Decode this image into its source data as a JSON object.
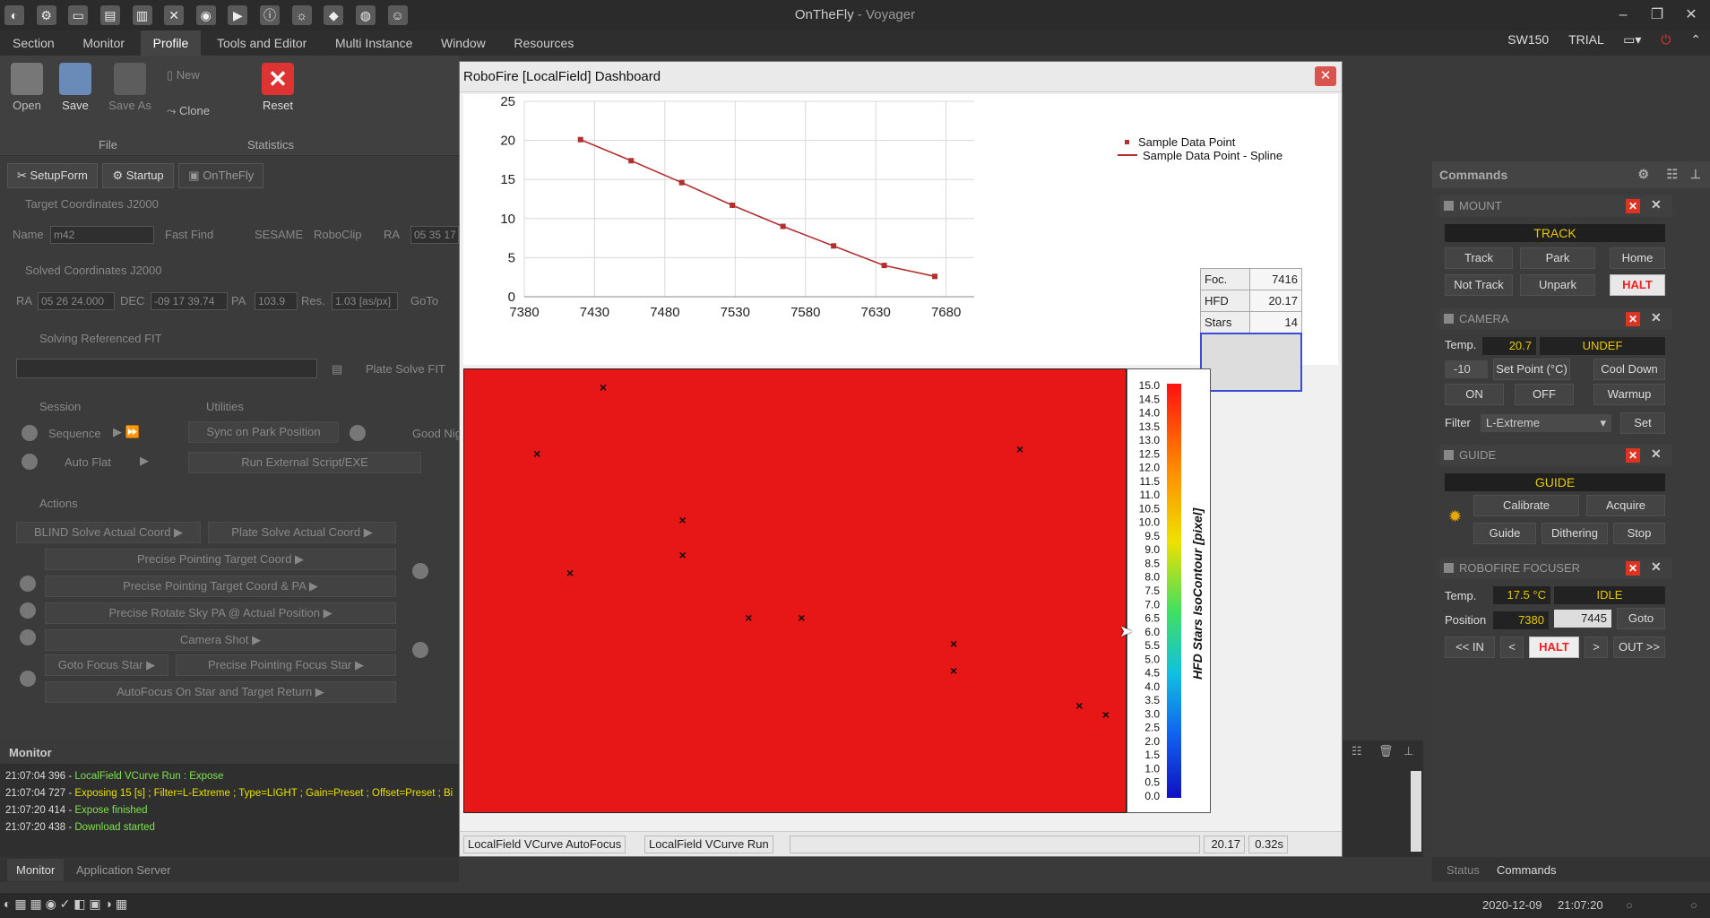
{
  "app": {
    "title": "OnTheFly",
    "subtitle": " - Voyager"
  },
  "menu": [
    "Section",
    "Monitor",
    "Profile",
    "Tools and Editor",
    "Multi Instance",
    "Window",
    "Resources"
  ],
  "topright": {
    "sw": "SW150",
    "trial": "TRIAL"
  },
  "ribbon": {
    "open": "Open",
    "save": "Save",
    "save_as": "Save As",
    "new": "New",
    "clone": "Clone",
    "reset": "Reset",
    "group_file": "File",
    "group_stats": "Statistics"
  },
  "lefttabs": [
    "SetupForm",
    "Startup",
    "OnTheFly"
  ],
  "left": {
    "target_coords": "Target Coordinates J2000",
    "name_label": "Name",
    "name_value": "m42",
    "fast_find": "Fast Find",
    "sesame": "SESAME",
    "roboclip": "RoboClip",
    "ra_label": "RA",
    "ra_value": "05 35 17",
    "solved_coords": "Solved Coordinates J2000",
    "ra2": "RA",
    "ra2_value": "05 26 24.000",
    "dec": "DEC",
    "dec_value": "-09 17 39.74",
    "pa": "PA",
    "pa_value": "103.9",
    "res": "Res.",
    "res_value": "1.03 [as/px]",
    "goto": "GoTo",
    "solving_ref": "Solving Referenced FIT",
    "plate_solve_fit": "Plate Solve FIT",
    "session": "Session",
    "utilities": "Utilities",
    "sequence": "Sequence",
    "sync_park": "Sync on Park Position",
    "good_night": "Good Nig",
    "auto_flat": "Auto Flat",
    "run_script": "Run External Script/EXE",
    "actions": "Actions",
    "blind_solve": "BLIND Solve Actual Coord",
    "plate_solve_actual": "Plate Solve Actual Coord",
    "pp_target": "Precise Pointing Target Coord",
    "pp_target_pa": "Precise Pointing Target Coord & PA",
    "pr_rotate": "Precise Rotate Sky PA @ Actual Position",
    "camera_shot": "Camera Shot",
    "goto_focus": "Goto Focus Star",
    "pp_focus": "Precise Pointing Focus Star",
    "autofocus_return": "AutoFocus On Star and Target Return"
  },
  "monitor": {
    "title": "Monitor",
    "logs": [
      {
        "text": "21:07:04 396 - ",
        "msg": "LocalField VCurve Run : Expose",
        "color": "#7ee34a"
      },
      {
        "text": "21:07:04 727 - ",
        "msg": "Exposing 15 [s] ; Filter=L-Extreme ; Type=LIGHT ; Gain=Preset ; Offset=Preset ; Bi",
        "color": "#e8e000"
      },
      {
        "text": "21:07:20 414 - ",
        "msg": "Expose finished",
        "color": "#7ee34a"
      },
      {
        "text": "21:07:20 438 - ",
        "msg": "Download started",
        "color": "#7ee34a"
      }
    ],
    "tabs": [
      "Monitor",
      "Application Server"
    ]
  },
  "status": {
    "date": "2020-12-09",
    "time": "21:07:20"
  },
  "commands": {
    "title": "Commands",
    "mount": {
      "label": "MOUNT",
      "banner": "TRACK",
      "track": "Track",
      "park": "Park",
      "home": "Home",
      "not_track": "Not Track",
      "unpark": "Unpark",
      "halt": "HALT"
    },
    "camera": {
      "label": "CAMERA",
      "temp_label": "Temp.",
      "temp": "20.7",
      "state": "UNDEF",
      "setpoint": "-10",
      "set_point": "Set Point (°C)",
      "cool_down": "Cool Down",
      "on": "ON",
      "off": "OFF",
      "warmup": "Warmup",
      "filter_label": "Filter",
      "filter": "L-Extreme",
      "set": "Set"
    },
    "guide": {
      "label": "GUIDE",
      "banner": "GUIDE",
      "calibrate": "Calibrate",
      "acquire": "Acquire",
      "guide": "Guide",
      "dithering": "Dithering",
      "stop": "Stop"
    },
    "focuser": {
      "label": "ROBOFIRE FOCUSER",
      "temp_label": "Temp.",
      "temp": "17.5 °C",
      "state": "IDLE",
      "position_label": "Position",
      "position": "7380",
      "target": "7445",
      "goto": "Goto",
      "in": "<< IN",
      "lt": "<",
      "halt": "HALT",
      "gt": ">",
      "out": "OUT >>"
    },
    "tabs": [
      "Status",
      "Commands"
    ]
  },
  "dialog": {
    "title": "RoboFire [LocalField] Dashboard",
    "info": {
      "foc_label": "Foc.",
      "foc": "7416",
      "hfd_label": "HFD",
      "hfd": "20.17",
      "stars_label": "Stars",
      "stars": "14"
    },
    "legend": {
      "point": "Sample Data Point",
      "spline": "Sample Data Point - Spline"
    },
    "scale_title": "HFD Stars IsoContour [pixel]",
    "scale_ticks": [
      "15.0",
      "14.5",
      "14.0",
      "13.5",
      "13.0",
      "12.5",
      "12.0",
      "11.5",
      "11.0",
      "10.5",
      "10.0",
      "9.5",
      "9.0",
      "8.5",
      "8.0",
      "7.5",
      "7.0",
      "6.5",
      "6.0",
      "5.5",
      "5.0",
      "4.5",
      "4.0",
      "3.5",
      "3.0",
      "2.5",
      "2.0",
      "1.5",
      "1.0",
      "0.5",
      "0.0"
    ],
    "statusbar": {
      "a": "LocalField VCurve AutoFocus",
      "b": "LocalField VCurve Run",
      "hfd": "20.17",
      "time": "0.32s"
    },
    "star_marks": [
      [
        0.21,
        0.04
      ],
      [
        0.11,
        0.19
      ],
      [
        0.84,
        0.18
      ],
      [
        0.33,
        0.34
      ],
      [
        0.33,
        0.42
      ],
      [
        0.16,
        0.46
      ],
      [
        0.43,
        0.56
      ],
      [
        0.51,
        0.56
      ],
      [
        0.74,
        0.62
      ],
      [
        0.74,
        0.68
      ],
      [
        0.93,
        0.76
      ],
      [
        0.97,
        0.78
      ]
    ]
  },
  "chart_data": {
    "type": "line",
    "x": [
      7420,
      7456,
      7492,
      7528,
      7564,
      7600,
      7636,
      7672
    ],
    "values": [
      20.1,
      17.4,
      14.6,
      11.7,
      9.0,
      6.5,
      4.0,
      2.6
    ],
    "series": [
      {
        "name": "Sample Data Point",
        "values": [
          20.1,
          17.4,
          14.6,
          11.7,
          9.0,
          6.5,
          4.0,
          2.6
        ]
      }
    ],
    "xticks": [
      "7380",
      "7430",
      "7480",
      "7530",
      "7580",
      "7630",
      "7680"
    ],
    "yticks": [
      "0",
      "5",
      "10",
      "15",
      "20",
      "25"
    ],
    "xlim": [
      7380,
      7700
    ],
    "ylim": [
      0,
      25
    ],
    "grid": true,
    "legend": "top-right",
    "title": "",
    "xlabel": "",
    "ylabel": ""
  }
}
